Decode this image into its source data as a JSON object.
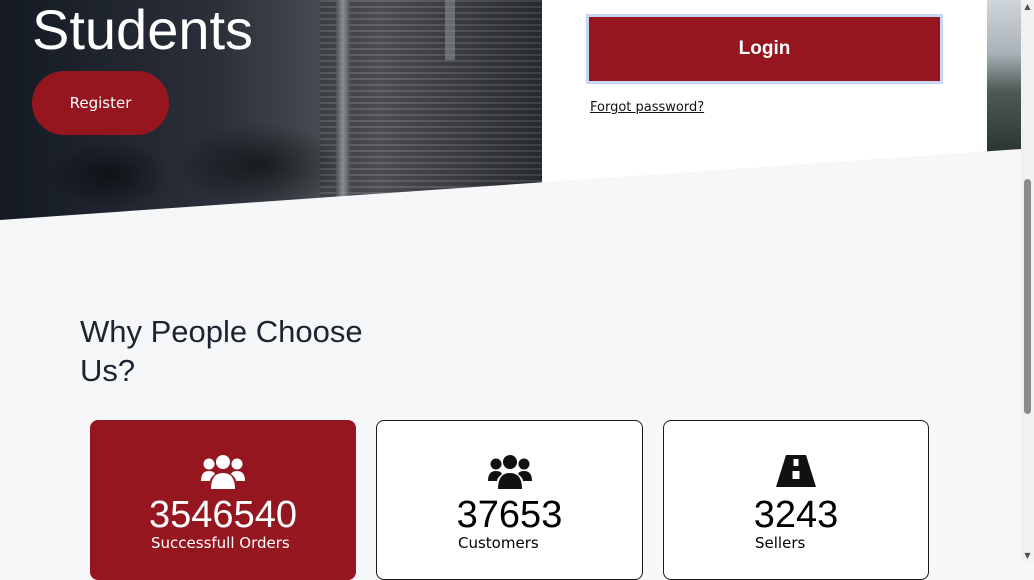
{
  "hero": {
    "title": "Students",
    "register_label": "Register"
  },
  "login": {
    "login_label": "Login",
    "forgot_label": "Forgot password?"
  },
  "section": {
    "title": "Why People Choose Us?"
  },
  "stats": [
    {
      "value": "3546540",
      "label": "Successfull Orders",
      "icon": "users-icon"
    },
    {
      "value": "37653",
      "label": "Customers",
      "icon": "users-icon"
    },
    {
      "value": "3243",
      "label": "Sellers",
      "icon": "road-icon"
    }
  ],
  "colors": {
    "brand": "#961620",
    "background": "#f6f7f9"
  }
}
